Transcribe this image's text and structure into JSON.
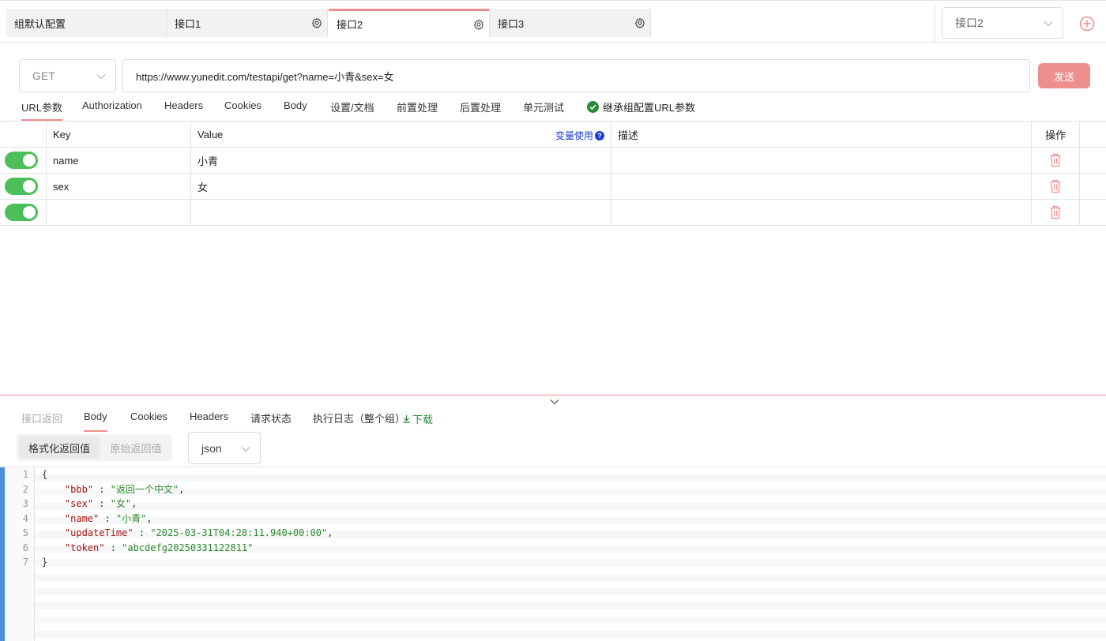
{
  "top_tabs": [
    {
      "label": "组默认配置",
      "gear": false
    },
    {
      "label": "接口1",
      "gear": true
    },
    {
      "label": "接口2",
      "gear": true,
      "active": true
    },
    {
      "label": "接口3",
      "gear": true
    }
  ],
  "api_select": {
    "value": "接口2"
  },
  "request": {
    "method": "GET",
    "url": "https://www.yunedit.com/testapi/get?name=小青&sex=女",
    "send_label": "发送"
  },
  "request_tabs": [
    "URL参数",
    "Authorization",
    "Headers",
    "Cookies",
    "Body",
    "设置/文档",
    "前置处理",
    "后置处理",
    "单元测试"
  ],
  "inherit_label": "继承组配置URL参数",
  "params_table": {
    "headers": {
      "key": "Key",
      "value": "Value",
      "var_use": "变量使用",
      "desc": "描述",
      "action": "操作"
    },
    "rows": [
      {
        "enabled": true,
        "key": "name",
        "value": "小青",
        "desc": ""
      },
      {
        "enabled": true,
        "key": "sex",
        "value": "女",
        "desc": ""
      },
      {
        "enabled": true,
        "key": "",
        "value": "",
        "desc": ""
      }
    ]
  },
  "response_tabs": [
    "接口返回",
    "Body",
    "Cookies",
    "Headers",
    "请求状态",
    "执行日志（整个组）"
  ],
  "download_label": "下载",
  "view_mode": {
    "formatted": "格式化返回值",
    "raw": "原始返回值"
  },
  "format_select": {
    "value": "json"
  },
  "code": {
    "line_numbers": [
      "1",
      "2",
      "3",
      "4",
      "5",
      "6",
      "7"
    ],
    "open_brace": "{",
    "close_brace": "}",
    "entries": [
      {
        "key": "\"bbb\"",
        "value": "\"返回一个中文\"",
        "comma": ","
      },
      {
        "key": "\"sex\"",
        "value": "\"女\"",
        "comma": ","
      },
      {
        "key": "\"name\"",
        "value": "\"小青\"",
        "comma": ","
      },
      {
        "key": "\"updateTime\"",
        "value": "\"2025-03-31T04:28:11.940+00:00\"",
        "comma": ","
      },
      {
        "key": "\"token\"",
        "value": "\"abcdefg20250331122811\"",
        "comma": ""
      }
    ]
  },
  "colors": {
    "accent": "#ef8e8e",
    "toggle_on": "#4cbf5a",
    "link": "#1a3cd6",
    "success": "#2a8a3a"
  }
}
